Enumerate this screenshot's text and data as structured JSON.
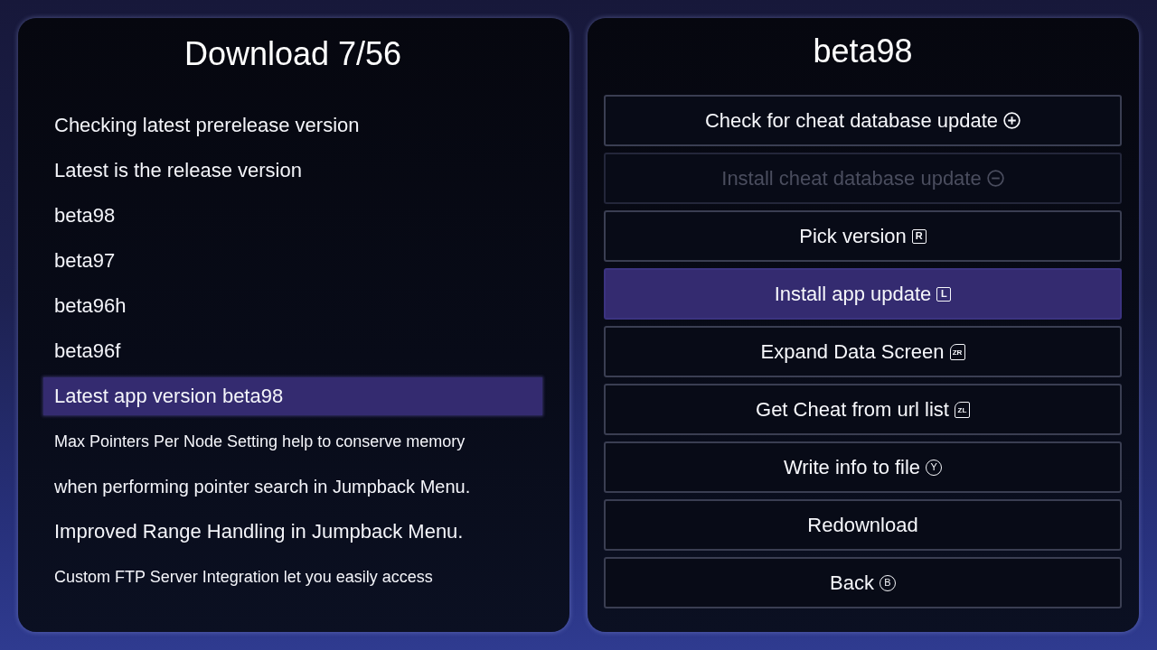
{
  "log_panel": {
    "title": "Download 7/56",
    "items": [
      {
        "text": "Checking latest prerelease version",
        "kind": "large",
        "selected": false
      },
      {
        "text": "Latest is the release version",
        "kind": "large",
        "selected": false
      },
      {
        "text": "beta98",
        "kind": "large",
        "selected": false
      },
      {
        "text": "beta97",
        "kind": "large",
        "selected": false
      },
      {
        "text": "beta96h",
        "kind": "large",
        "selected": false
      },
      {
        "text": "beta96f",
        "kind": "large",
        "selected": false
      },
      {
        "text": "Latest app version beta98",
        "kind": "large",
        "selected": true
      },
      {
        "text": "Max Pointers Per Node Setting help to conserve memory",
        "kind": "small",
        "selected": false
      },
      {
        "text": "when performing pointer search in Jumpback Menu.",
        "kind": "medium",
        "selected": false
      },
      {
        "text": "Improved Range Handling in Jumpback Menu.",
        "kind": "large",
        "selected": false
      },
      {
        "text": "Custom FTP Server Integration let you easily access",
        "kind": "small",
        "selected": false
      }
    ]
  },
  "menu_panel": {
    "title": "beta98",
    "buttons": [
      {
        "label": "Check for cheat database update",
        "icon": {
          "kind": "plus"
        },
        "selected": false,
        "disabled": false
      },
      {
        "label": "Install cheat database update",
        "icon": {
          "kind": "minus"
        },
        "selected": false,
        "disabled": true
      },
      {
        "label": "Pick version",
        "icon": {
          "kind": "square",
          "letter": "R"
        },
        "selected": false,
        "disabled": false
      },
      {
        "label": "Install app update",
        "icon": {
          "kind": "square",
          "letter": "L"
        },
        "selected": true,
        "disabled": false
      },
      {
        "label": "Expand Data Screen",
        "icon": {
          "kind": "trigger",
          "letter": "ZR"
        },
        "selected": false,
        "disabled": false
      },
      {
        "label": "Get Cheat from url list",
        "icon": {
          "kind": "trigger",
          "letter": "ZL"
        },
        "selected": false,
        "disabled": false
      },
      {
        "label": "Write info to file",
        "icon": {
          "kind": "circle",
          "letter": "Y"
        },
        "selected": false,
        "disabled": false
      },
      {
        "label": "Redownload",
        "selected": false,
        "disabled": false
      },
      {
        "label": "Back",
        "icon": {
          "kind": "circle",
          "letter": "B"
        },
        "selected": false,
        "disabled": false
      }
    ]
  }
}
